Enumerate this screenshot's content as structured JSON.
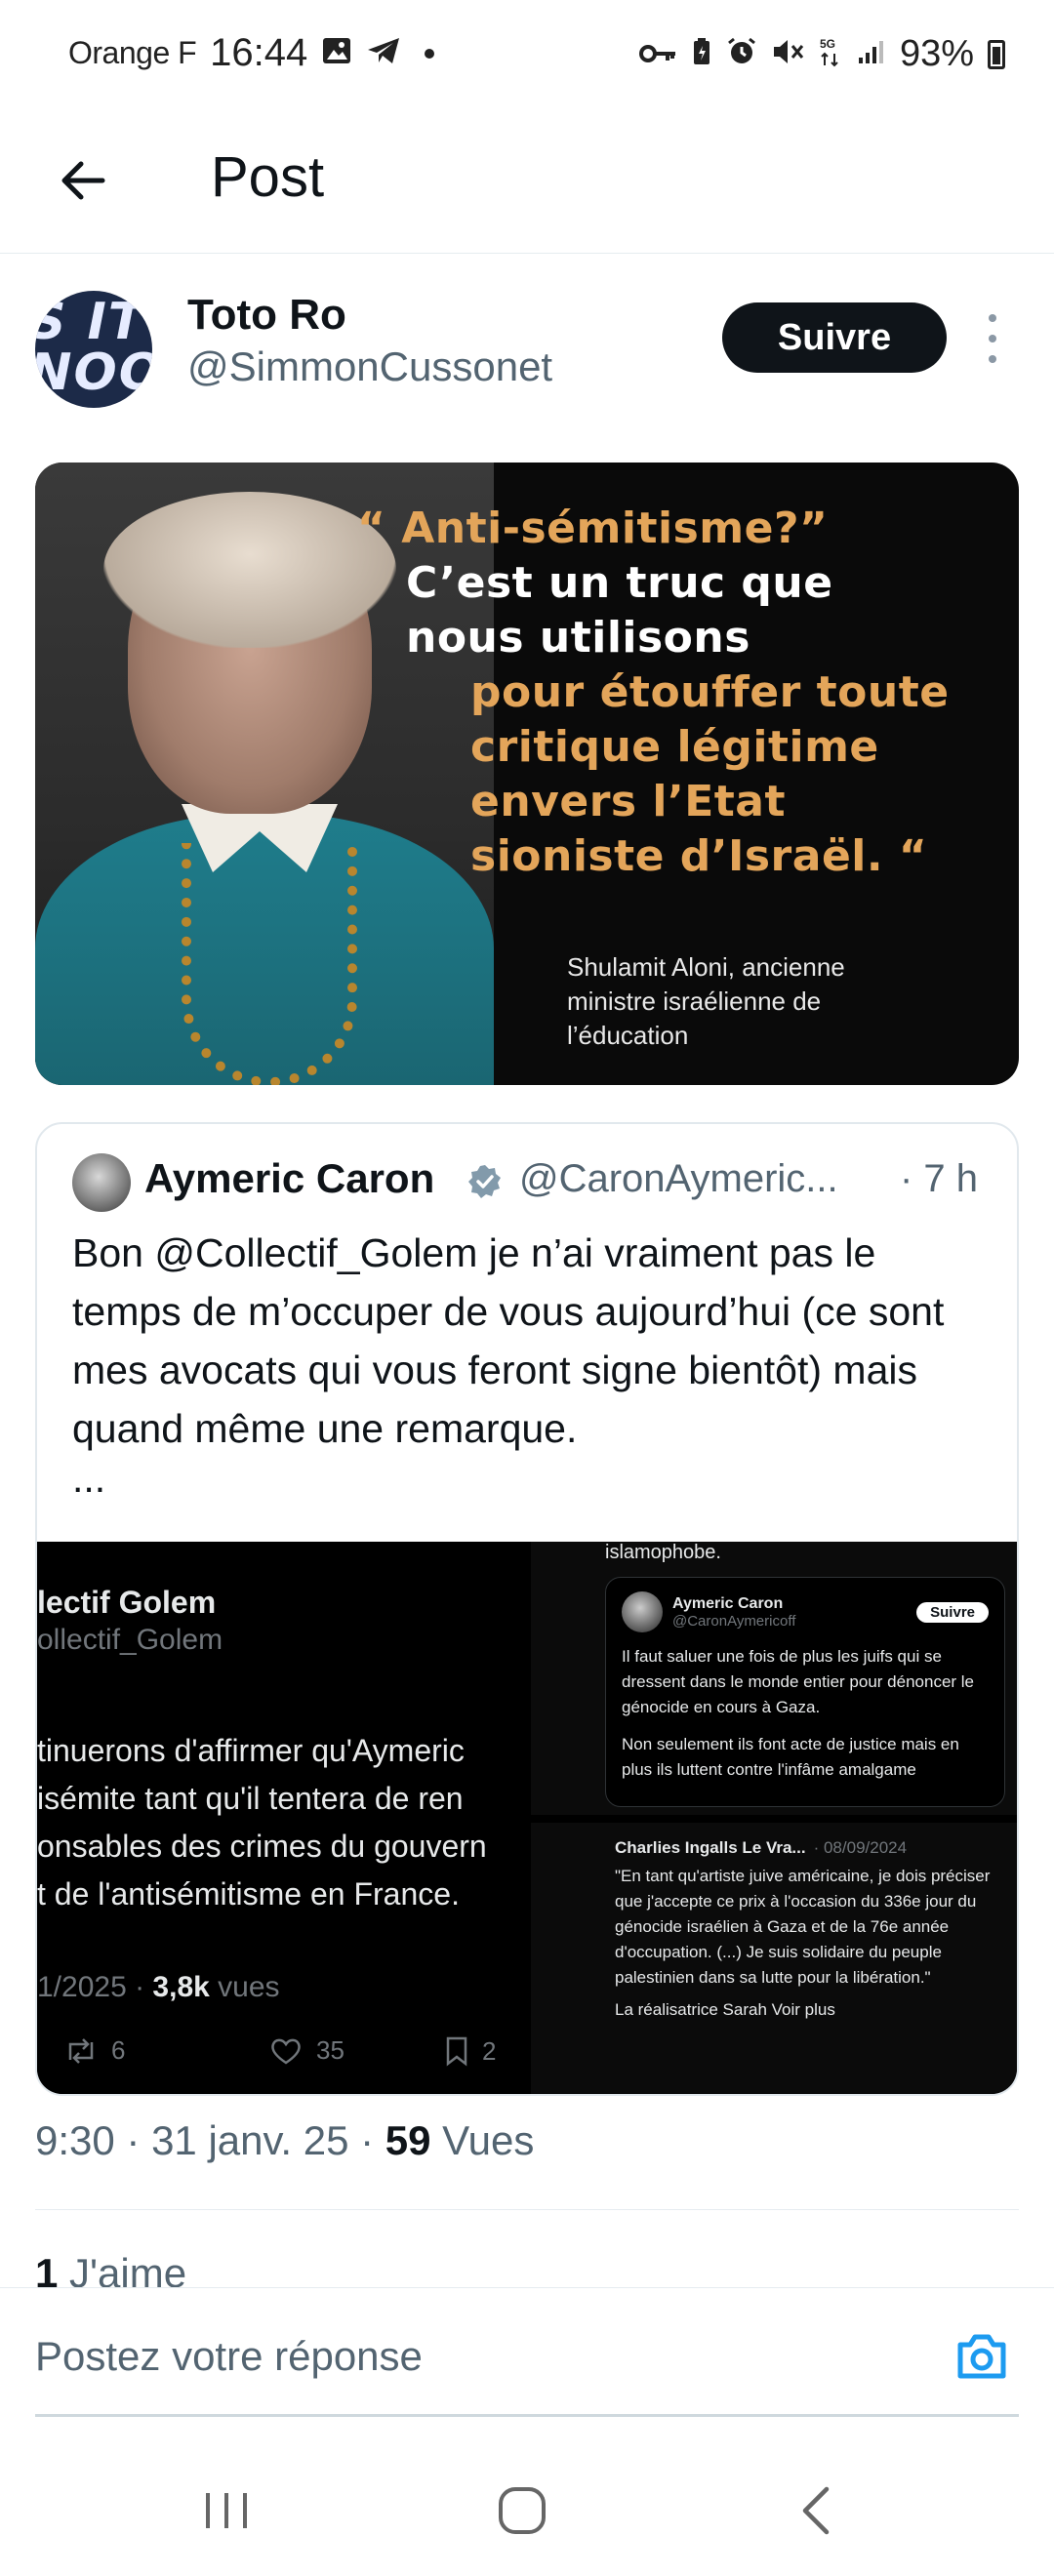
{
  "status_bar": {
    "carrier": "Orange F",
    "time": "16:44",
    "network": "5G",
    "battery": "93%"
  },
  "header": {
    "title": "Post"
  },
  "author": {
    "avatar_text_line1": "S IT",
    "avatar_text_line2": "NOO",
    "name": "Toto Ro",
    "handle": "@SimmonCussonet",
    "follow_label": "Suivre"
  },
  "media_image": {
    "quote_line1": "“ Anti-sémitisme?”",
    "quote_line2": "C’est un truc que",
    "quote_line3": "nous utilisons",
    "quote_line4": "pour étouffer toute",
    "quote_line5": "critique légitime",
    "quote_line6": "envers l’Etat",
    "quote_line7": "sioniste d’Israël. “",
    "caption_line1": "Shulamit Aloni, ancienne",
    "caption_line2": "ministre israélienne de",
    "caption_line3": "l’éducation"
  },
  "quoted_post": {
    "name": "Aymeric Caron",
    "handle": "@CaronAymeric...",
    "time": "· 7 h",
    "text": "Bon @Collectif_Golem je n’ai vraiment pas le temps de m’occuper de vous aujourd’hui (ce sont mes avocats qui vous feront signe bientôt) mais quand même une remarque.",
    "ellipsis": "...",
    "media": {
      "left": {
        "name": "lectif Golem",
        "handle": "ollectif_Golem",
        "line1": "tinuerons d'affirmer qu'Aymeric",
        "line2": "isémite tant qu'il tentera de ren",
        "line3": "onsables des crimes du gouvern",
        "line4": "t de l'antisémitisme en France.",
        "meta_date": "1/2025 · ",
        "meta_views": "3,8k",
        "meta_views_label": " vues",
        "retweets": "6",
        "likes": "35",
        "bookmarks": "2"
      },
      "top_right": {
        "top_text": "islamophobe.",
        "name": "Aymeric Caron",
        "handle": "@CaronAymericoff",
        "follow": "Suivre",
        "para1": "Il faut saluer une fois de plus les juifs qui se dressent dans le monde entier pour dénoncer le génocide en cours à Gaza.",
        "para2": "Non seulement ils font acte de justice mais en plus ils luttent contre l'infâme amalgame"
      },
      "bottom_right": {
        "name": "Charlies Ingalls Le Vra...",
        "date": "· 08/09/2024",
        "text": "\"En tant qu'artiste juive américaine, je dois préciser que j'accepte ce prix à l'occasion du 336e jour du génocide israélien à Gaza et de la 76e année d'occupation. (...) Je suis solidaire du peuple palestinien dans sa lutte pour la libération.\"",
        "more": "La réalisatrice Sarah Voir plus"
      }
    }
  },
  "post_meta": {
    "time": "9:30 · 31 janv. 25 · ",
    "views_count": "59",
    "views_label": " Vues"
  },
  "likes": {
    "count": "1",
    "label": " J'aime"
  },
  "reply": {
    "placeholder": "Postez votre réponse"
  },
  "colors": {
    "accent": "#1d9bf0",
    "text_primary": "#0f1419",
    "text_secondary": "#536471",
    "image_orange": "#e3a55a"
  }
}
